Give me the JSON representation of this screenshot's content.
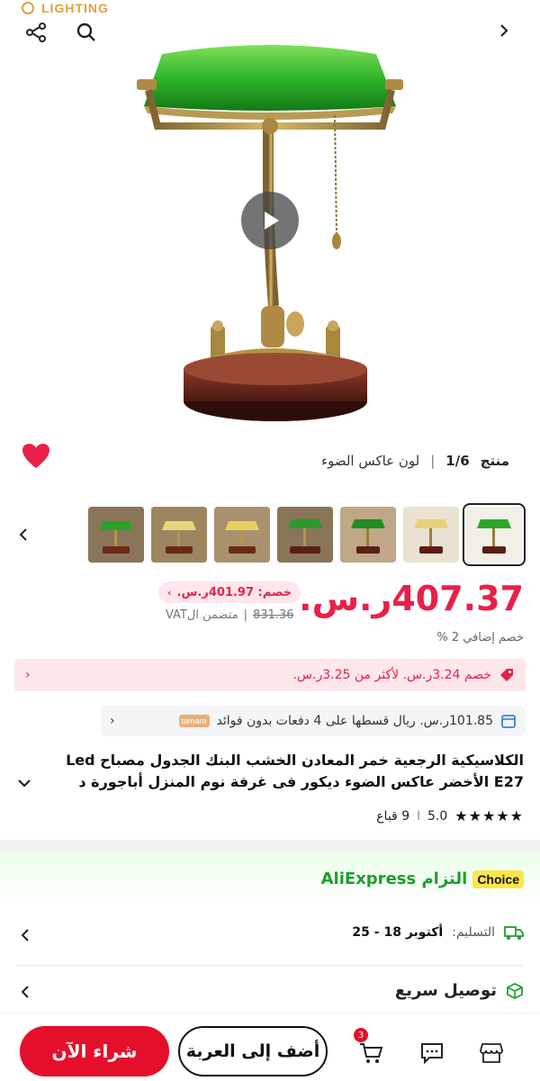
{
  "brand": {
    "name": "LIGHTING"
  },
  "hero": {
    "icons": [
      "share-icon",
      "search-icon",
      "chevron-right-icon"
    ],
    "play_label": "play"
  },
  "product_header": {
    "count_label": "منتج",
    "count_value": "1/6",
    "separator": "|",
    "variant": "لون عاكس الضوء"
  },
  "thumbnails": [
    {
      "selected": true
    },
    {
      "selected": false
    },
    {
      "selected": false
    },
    {
      "selected": false
    },
    {
      "selected": false
    },
    {
      "selected": false
    },
    {
      "selected": false
    }
  ],
  "price": {
    "current": "407.37ر.س.",
    "discount_pill": "خصم: 401.97ر.س.",
    "old": "831.36",
    "vat": "متضمن الVAT",
    "vat_sep": "|",
    "extra_discount": "خصم إضافي 2 %"
  },
  "coupon": {
    "text": "خصم 3.24ر.س. لأكثر من 3.25ر.س."
  },
  "installments": {
    "text": "101.85ر.س. ريال قسطها على 4 دفعات بدون فوائد",
    "logo": "tamara"
  },
  "title": {
    "text": "الكلاسيكية الرجعية خمر المعادن الخشب البنك الجدول مصباح Led E27 الأخضر عاكس الضوء ديكور فى غرفة نوم المنزل أباجورة د"
  },
  "rating": {
    "score": "5.0",
    "sep": "ا",
    "sold": "9 قباع"
  },
  "choice": {
    "badge": "Choice",
    "text": "التزام AliExpress"
  },
  "delivery": {
    "label": "التسليم:",
    "value": "أكتوبر 18 - 25"
  },
  "fast": {
    "text": "توصيل سريع"
  },
  "bottom": {
    "buy": "شراء الآن",
    "add": "أضف إلى العربة",
    "cart_count": "3"
  },
  "colors": {
    "accent": "#e8204a",
    "buy": "#e50f2b",
    "choice_green": "#1e9e2f",
    "choice_badge": "#fbe64a"
  }
}
